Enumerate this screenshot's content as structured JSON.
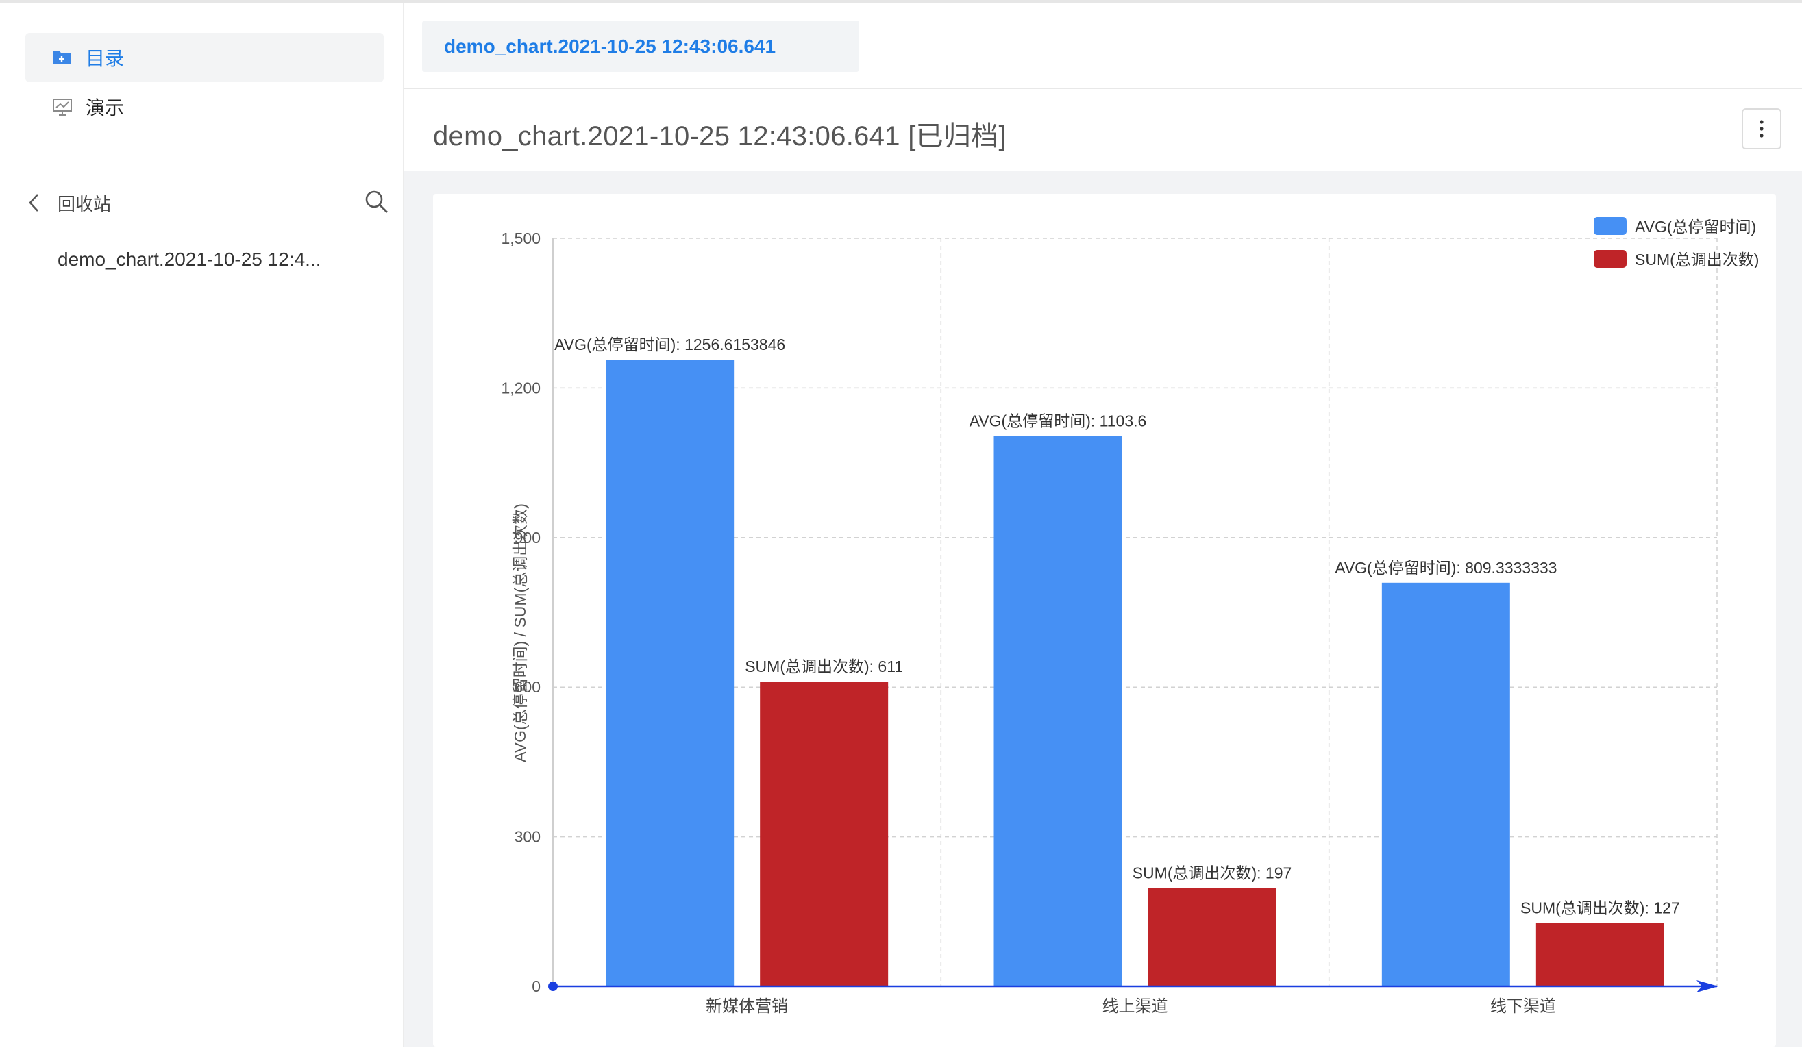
{
  "sidebar": {
    "items": [
      {
        "label": "目录",
        "icon": "folder-icon",
        "active": true
      },
      {
        "label": "演示",
        "icon": "presentation-icon",
        "active": false
      }
    ],
    "recycle_label": "回收站",
    "archived_items": [
      "demo_chart.2021-10-25 12:4..."
    ]
  },
  "tabbar": {
    "tab_label": "demo_chart.2021-10-25 12:43:06.641"
  },
  "header": {
    "title": "demo_chart.2021-10-25 12:43:06.641 [已归档]"
  },
  "colors": {
    "accent": "#1f7de6",
    "avg": "#4690f4",
    "sum": "#bf2428",
    "axis": "#1a3fe0"
  },
  "chart_data": {
    "type": "bar",
    "categories": [
      "新媒体营销",
      "线上渠道",
      "线下渠道"
    ],
    "series": [
      {
        "name": "AVG(总停留时间)",
        "values": [
          1256.6153846,
          1103.6,
          809.3333333
        ],
        "labels": [
          "AVG(总停留时间): 1256.6153846",
          "AVG(总停留时间): 1103.6",
          "AVG(总停留时间): 809.3333333"
        ]
      },
      {
        "name": "SUM(总调出次数)",
        "values": [
          611,
          197,
          127
        ],
        "labels": [
          "SUM(总调出次数): 611",
          "SUM(总调出次数): 197",
          "SUM(总调出次数): 127"
        ]
      }
    ],
    "ylabel": "AVG(总停留时间) / SUM(总调出次数)",
    "ylim": [
      0,
      1500
    ],
    "yticks": [
      0,
      300,
      600,
      900,
      1200,
      1500
    ],
    "ytick_labels": [
      "0",
      "300",
      "600",
      "900",
      "1,200",
      "1,500"
    ],
    "legend_position": "top-right",
    "grid": true
  }
}
